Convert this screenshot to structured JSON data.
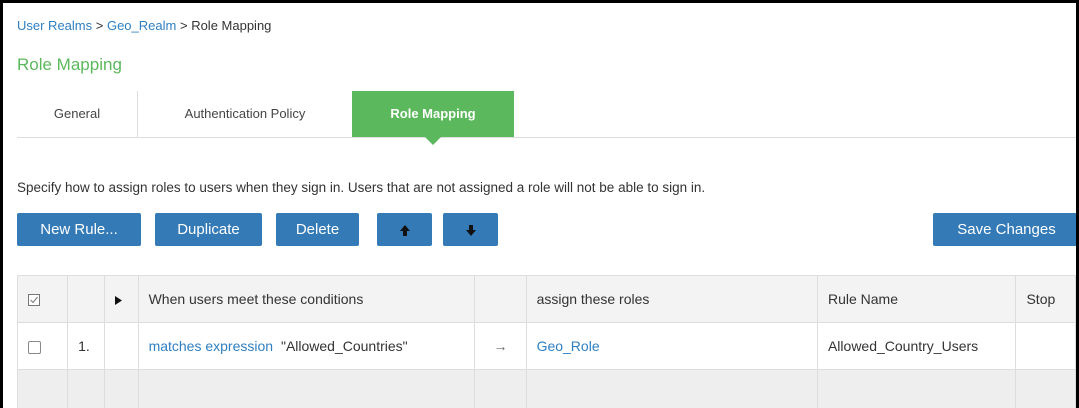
{
  "breadcrumb": {
    "items": [
      "User Realms",
      "Geo_Realm",
      "Role Mapping"
    ],
    "separator": ">"
  },
  "page_title": "Role Mapping",
  "tabs": [
    {
      "label": "General"
    },
    {
      "label": "Authentication Policy"
    },
    {
      "label": "Role Mapping",
      "active": true
    }
  ],
  "description": "Specify how to assign roles to users when they sign in. Users that are not assigned a role will not be able to sign in.",
  "toolbar": {
    "new_rule_label": "New Rule...",
    "duplicate_label": "Duplicate",
    "delete_label": "Delete",
    "move_up_icon": "arrow-up-icon",
    "move_down_icon": "arrow-down-icon",
    "save_label": "Save Changes"
  },
  "table": {
    "headers": {
      "select_all_icon": "select-all-checkbox-icon",
      "number": "",
      "expand_icon": "triangle-right-icon",
      "conditions": "When users meet these conditions",
      "arrow": "",
      "roles": "assign these roles",
      "rule_name": "Rule Name",
      "stop": "Stop"
    },
    "rows": [
      {
        "number": "1.",
        "condition_link": "matches expression",
        "condition_value": "\"Allowed_Countries\"",
        "arrow": "→",
        "role": "Geo_Role",
        "rule_name": "Allowed_Country_Users"
      }
    ]
  },
  "colors": {
    "accent_green": "#5cb85c",
    "button_blue": "#337ab7",
    "link_blue": "#2f7fc1"
  }
}
